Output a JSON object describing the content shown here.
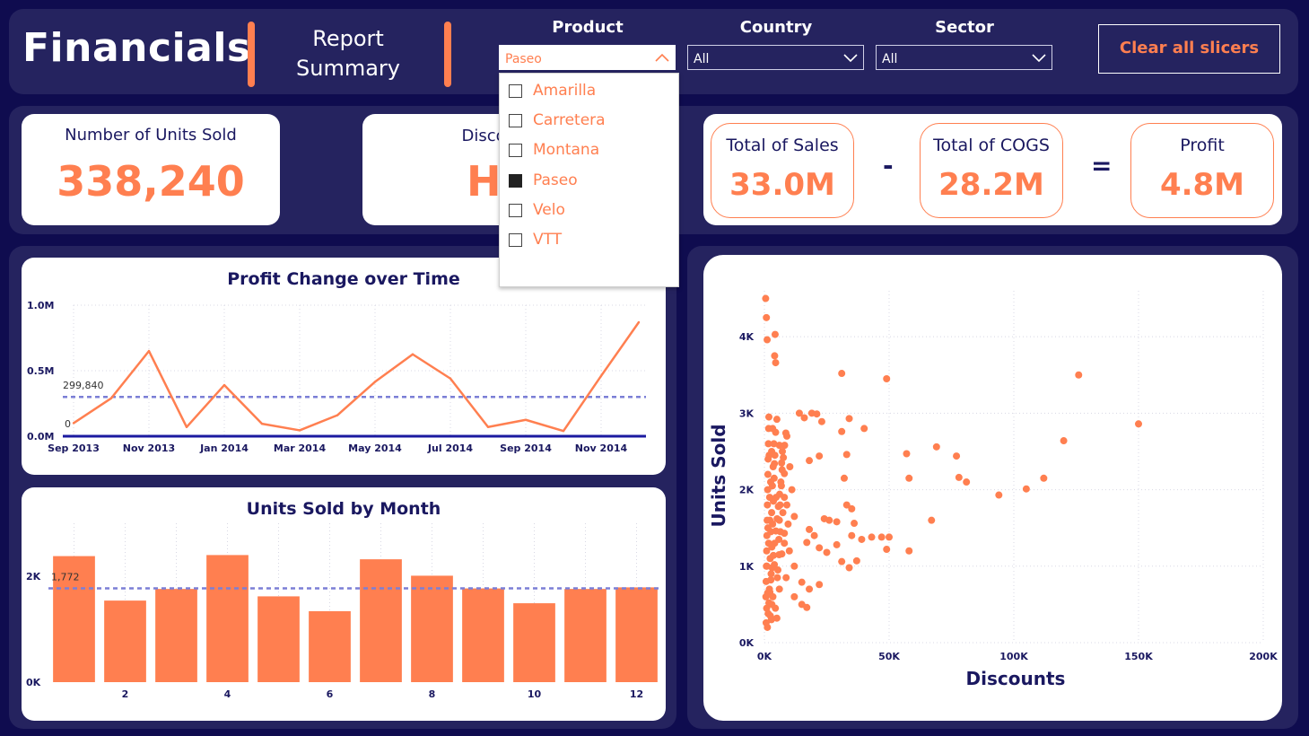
{
  "header": {
    "title": "Financials",
    "report_line1": "Report",
    "report_line2": "Summary",
    "clear_label": "Clear all slicers"
  },
  "slicers": [
    {
      "label": "Product",
      "value": "Paseo"
    },
    {
      "label": "Country",
      "value": "All"
    },
    {
      "label": "Sector",
      "value": "All"
    }
  ],
  "product_dropdown": {
    "options": [
      {
        "label": "Amarilla",
        "checked": false
      },
      {
        "label": "Carretera",
        "checked": false
      },
      {
        "label": "Montana",
        "checked": false
      },
      {
        "label": "Paseo",
        "checked": true
      },
      {
        "label": "Velo",
        "checked": false
      },
      {
        "label": "VTT",
        "checked": false
      }
    ]
  },
  "kpis": {
    "units_sold": {
      "label": "Number of Units Sold",
      "value": "338,240"
    },
    "discount_band": {
      "label": "Discount Band",
      "value": "High"
    },
    "total_sales": {
      "label": "Total of Sales",
      "value": "33.0M"
    },
    "total_cogs": {
      "label": "Total of COGS",
      "value": "28.2M"
    },
    "profit": {
      "label": "Profit",
      "value": "4.8M"
    },
    "minus_op": "-",
    "equals_op": "="
  },
  "colors": {
    "accent": "#ff7f50",
    "navy": "#1a1860",
    "background": "#0f0c4f",
    "panel": "#25235f",
    "reference": "#7b7fd6"
  },
  "chart_data": [
    {
      "type": "line",
      "title": "Profit Change over Time",
      "x": [
        "Sep 2013",
        "Oct 2013",
        "Nov 2013",
        "Dec 2013",
        "Jan 2014",
        "Feb 2014",
        "Mar 2014",
        "Apr 2014",
        "May 2014",
        "Jun 2014",
        "Jul 2014",
        "Aug 2014",
        "Sep 2014",
        "Oct 2014",
        "Nov 2014",
        "Dec 2014"
      ],
      "xticks": [
        "Sep 2013",
        "Nov 2013",
        "Jan 2014",
        "Mar 2014",
        "May 2014",
        "Jul 2014",
        "Sep 2014",
        "Nov 2014"
      ],
      "values": [
        100000,
        290000,
        650000,
        70000,
        390000,
        95000,
        45000,
        160000,
        415000,
        625000,
        440000,
        70000,
        125000,
        40000,
        460000,
        870000
      ],
      "average": 299840,
      "average_label": "299,840",
      "zero_label": "0",
      "ylim": [
        0,
        1000000
      ],
      "yticks": [
        {
          "v": 0,
          "label": "0.0M"
        },
        {
          "v": 500000,
          "label": "0.5M"
        },
        {
          "v": 1000000,
          "label": "1.0M"
        }
      ]
    },
    {
      "type": "bar",
      "title": "Units Sold by Month",
      "categories": [
        "1",
        "2",
        "3",
        "4",
        "5",
        "6",
        "7",
        "8",
        "9",
        "10",
        "11",
        "12"
      ],
      "xticks": [
        "2",
        "4",
        "6",
        "8",
        "10",
        "12"
      ],
      "values": [
        2380,
        1540,
        1760,
        2400,
        1620,
        1340,
        2320,
        2010,
        1770,
        1490,
        1760,
        1790
      ],
      "average": 1772,
      "average_label": "1,772",
      "ylim": [
        0,
        3000
      ],
      "yticks": [
        {
          "v": 0,
          "label": "0K"
        },
        {
          "v": 2000,
          "label": "2K"
        }
      ]
    },
    {
      "type": "scatter",
      "xlabel": "Discounts",
      "ylabel": "Units Sold",
      "xlim": [
        0,
        200000
      ],
      "ylim": [
        0,
        4600
      ],
      "xticks": [
        {
          "v": 0,
          "label": "0K"
        },
        {
          "v": 50000,
          "label": "50K"
        },
        {
          "v": 100000,
          "label": "100K"
        },
        {
          "v": 150000,
          "label": "150K"
        },
        {
          "v": 200000,
          "label": "200K"
        }
      ],
      "yticks": [
        {
          "v": 0,
          "label": "0K"
        },
        {
          "v": 1000,
          "label": "1K"
        },
        {
          "v": 2000,
          "label": "2K"
        },
        {
          "v": 3000,
          "label": "3K"
        },
        {
          "v": 4000,
          "label": "4K"
        }
      ],
      "points": [
        [
          500,
          4500
        ],
        [
          800,
          4250
        ],
        [
          4300,
          4030
        ],
        [
          1100,
          3960
        ],
        [
          4100,
          3750
        ],
        [
          4500,
          3660
        ],
        [
          31000,
          3520
        ],
        [
          49000,
          3450
        ],
        [
          126000,
          3500
        ],
        [
          150000,
          2860
        ],
        [
          120000,
          2640
        ],
        [
          14000,
          3000
        ],
        [
          19000,
          3000
        ],
        [
          21000,
          2990
        ],
        [
          23000,
          2890
        ],
        [
          16000,
          2940
        ],
        [
          34000,
          2930
        ],
        [
          31000,
          2760
        ],
        [
          69000,
          2560
        ],
        [
          77000,
          2440
        ],
        [
          57000,
          2470
        ],
        [
          40000,
          2800
        ],
        [
          33000,
          2460
        ],
        [
          22000,
          2440
        ],
        [
          18000,
          2380
        ],
        [
          58000,
          2150
        ],
        [
          78000,
          2160
        ],
        [
          81000,
          2100
        ],
        [
          94000,
          1930
        ],
        [
          105000,
          2010
        ],
        [
          112000,
          2150
        ],
        [
          32000,
          2150
        ],
        [
          33000,
          1800
        ],
        [
          67000,
          1600
        ],
        [
          47000,
          1380
        ],
        [
          50000,
          1380
        ],
        [
          49000,
          1220
        ],
        [
          58000,
          1200
        ],
        [
          43000,
          1380
        ],
        [
          39000,
          1350
        ],
        [
          35000,
          1400
        ],
        [
          24000,
          1620
        ],
        [
          26000,
          1600
        ],
        [
          29000,
          1580
        ],
        [
          35000,
          1750
        ],
        [
          36000,
          1560
        ],
        [
          20000,
          1400
        ],
        [
          22000,
          1240
        ],
        [
          25000,
          1180
        ],
        [
          29000,
          1280
        ],
        [
          31000,
          1060
        ],
        [
          34000,
          980
        ],
        [
          37000,
          1070
        ],
        [
          17000,
          1310
        ],
        [
          18000,
          1480
        ],
        [
          12000,
          1650
        ],
        [
          10000,
          1200
        ],
        [
          7000,
          1160
        ],
        [
          12000,
          1000
        ],
        [
          15000,
          790
        ],
        [
          18000,
          700
        ],
        [
          22000,
          760
        ],
        [
          15000,
          500
        ],
        [
          12000,
          600
        ],
        [
          17000,
          460
        ],
        [
          8000,
          1430
        ],
        [
          6000,
          1600
        ],
        [
          9000,
          1800
        ],
        [
          11000,
          2000
        ],
        [
          8000,
          2210
        ],
        [
          4000,
          2340
        ],
        [
          6000,
          2580
        ],
        [
          9000,
          2700
        ],
        [
          5000,
          2920
        ],
        [
          8000,
          1900
        ],
        [
          4000,
          1020
        ],
        [
          6000,
          700
        ],
        [
          3000,
          500
        ],
        [
          5000,
          320
        ],
        [
          700,
          260
        ],
        [
          1200,
          200
        ],
        [
          1500,
          380
        ],
        [
          1800,
          520
        ],
        [
          2200,
          660
        ],
        [
          2600,
          820
        ],
        [
          3100,
          980
        ],
        [
          3600,
          1140
        ],
        [
          4100,
          1300
        ],
        [
          4600,
          1460
        ],
        [
          5100,
          1620
        ],
        [
          5600,
          1780
        ],
        [
          6100,
          1940
        ],
        [
          6600,
          2100
        ],
        [
          7100,
          2260
        ],
        [
          7600,
          2420
        ],
        [
          8100,
          2580
        ],
        [
          8600,
          2740
        ],
        [
          600,
          600
        ],
        [
          700,
          800
        ],
        [
          800,
          1000
        ],
        [
          900,
          1200
        ],
        [
          1000,
          1400
        ],
        [
          1100,
          1600
        ],
        [
          1200,
          1800
        ],
        [
          1300,
          2000
        ],
        [
          1400,
          2200
        ],
        [
          1500,
          2400
        ],
        [
          1600,
          2600
        ],
        [
          1700,
          2800
        ],
        [
          1800,
          2950
        ],
        [
          2400,
          350
        ],
        [
          2700,
          900
        ],
        [
          3000,
          1250
        ],
        [
          3300,
          1550
        ],
        [
          3600,
          1850
        ],
        [
          3900,
          2150
        ],
        [
          4200,
          2450
        ],
        [
          4500,
          2750
        ],
        [
          2000,
          700
        ],
        [
          2300,
          1100
        ],
        [
          2600,
          1450
        ],
        [
          2900,
          1700
        ],
        [
          3200,
          2050
        ],
        [
          3500,
          2300
        ],
        [
          3800,
          2600
        ],
        [
          4400,
          450
        ],
        [
          5200,
          850
        ],
        [
          5800,
          1350
        ],
        [
          6300,
          1800
        ],
        [
          6900,
          2350
        ],
        [
          7400,
          1700
        ],
        [
          8000,
          1300
        ],
        [
          8700,
          850
        ],
        [
          9500,
          1550
        ],
        [
          10200,
          2300
        ],
        [
          900,
          450
        ],
        [
          1300,
          650
        ],
        [
          1700,
          1300
        ],
        [
          2100,
          1900
        ],
        [
          2500,
          2100
        ],
        [
          2900,
          2500
        ],
        [
          3300,
          2800
        ],
        [
          5400,
          950
        ],
        [
          5900,
          1150
        ],
        [
          6400,
          1450
        ],
        [
          6800,
          2050
        ],
        [
          7200,
          2500
        ],
        [
          2200,
          1600
        ],
        [
          3400,
          600
        ],
        [
          4700,
          1900
        ],
        [
          1000,
          1000
        ],
        [
          1400,
          1500
        ],
        [
          1900,
          2450
        ],
        [
          2800,
          300
        ]
      ]
    }
  ]
}
